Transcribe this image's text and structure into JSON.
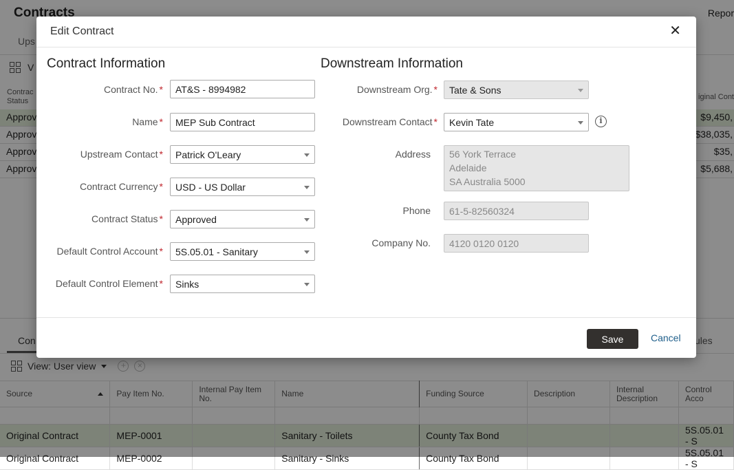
{
  "background": {
    "page_title": "Contracts",
    "reports_label": "Repor",
    "top_tab": "Ups",
    "top_view_label": "V",
    "status_header": [
      "Contrac",
      "Status"
    ],
    "status_rows": [
      "Approv",
      "Approv",
      "Approv",
      "Approv"
    ],
    "original_header": "iginal Cont",
    "original_rows": [
      "$9,450,",
      "$38,035,",
      "$35,",
      "$5,688,"
    ],
    "bottom_tab": "Con",
    "bottom_tab_right": "ules",
    "bottom_view_label": "View: User view",
    "lines_table": {
      "columns": [
        "Source",
        "Pay Item No.",
        "Internal Pay Item No.",
        "Name",
        "Funding Source",
        "Description",
        "Internal Description",
        "Control Acco"
      ],
      "rows": [
        [
          "Original Contract",
          "MEP-0001",
          "",
          "Sanitary - Toilets",
          "County Tax Bond",
          "",
          "",
          "5S.05.01 - S"
        ],
        [
          "Original Contract",
          "MEP-0002",
          "",
          "Sanitary - Sinks",
          "County Tax Bond",
          "",
          "",
          "5S.05.01 - S"
        ]
      ]
    }
  },
  "dialog": {
    "title": "Edit Contract",
    "close_glyph": "✕",
    "contract_section": {
      "title": "Contract Information",
      "contract_no_label": "Contract No.",
      "contract_no_value": "AT&S - 8994982",
      "name_label": "Name",
      "name_value": "MEP Sub Contract",
      "upstream_contact_label": "Upstream Contact",
      "upstream_contact_value": "Patrick O'Leary",
      "currency_label": "Contract Currency",
      "currency_value": "USD - US Dollar",
      "status_label": "Contract Status",
      "status_value": "Approved",
      "control_account_label": "Default Control Account",
      "control_account_value": "5S.05.01 - Sanitary",
      "control_element_label": "Default Control Element",
      "control_element_value": "Sinks"
    },
    "downstream_section": {
      "title": "Downstream Information",
      "org_label": "Downstream Org.",
      "org_value": "Tate & Sons",
      "contact_label": "Downstream Contact",
      "contact_value": "Kevin Tate",
      "address_label": "Address",
      "address_lines": [
        "56 York Terrace",
        "Adelaide",
        "SA Australia 5000"
      ],
      "phone_label": "Phone",
      "phone_value": "61-5-82560324",
      "company_no_label": "Company No.",
      "company_no_value": "4120 0120 0120"
    },
    "required_marker": "*",
    "save_label": "Save",
    "cancel_label": "Cancel"
  }
}
